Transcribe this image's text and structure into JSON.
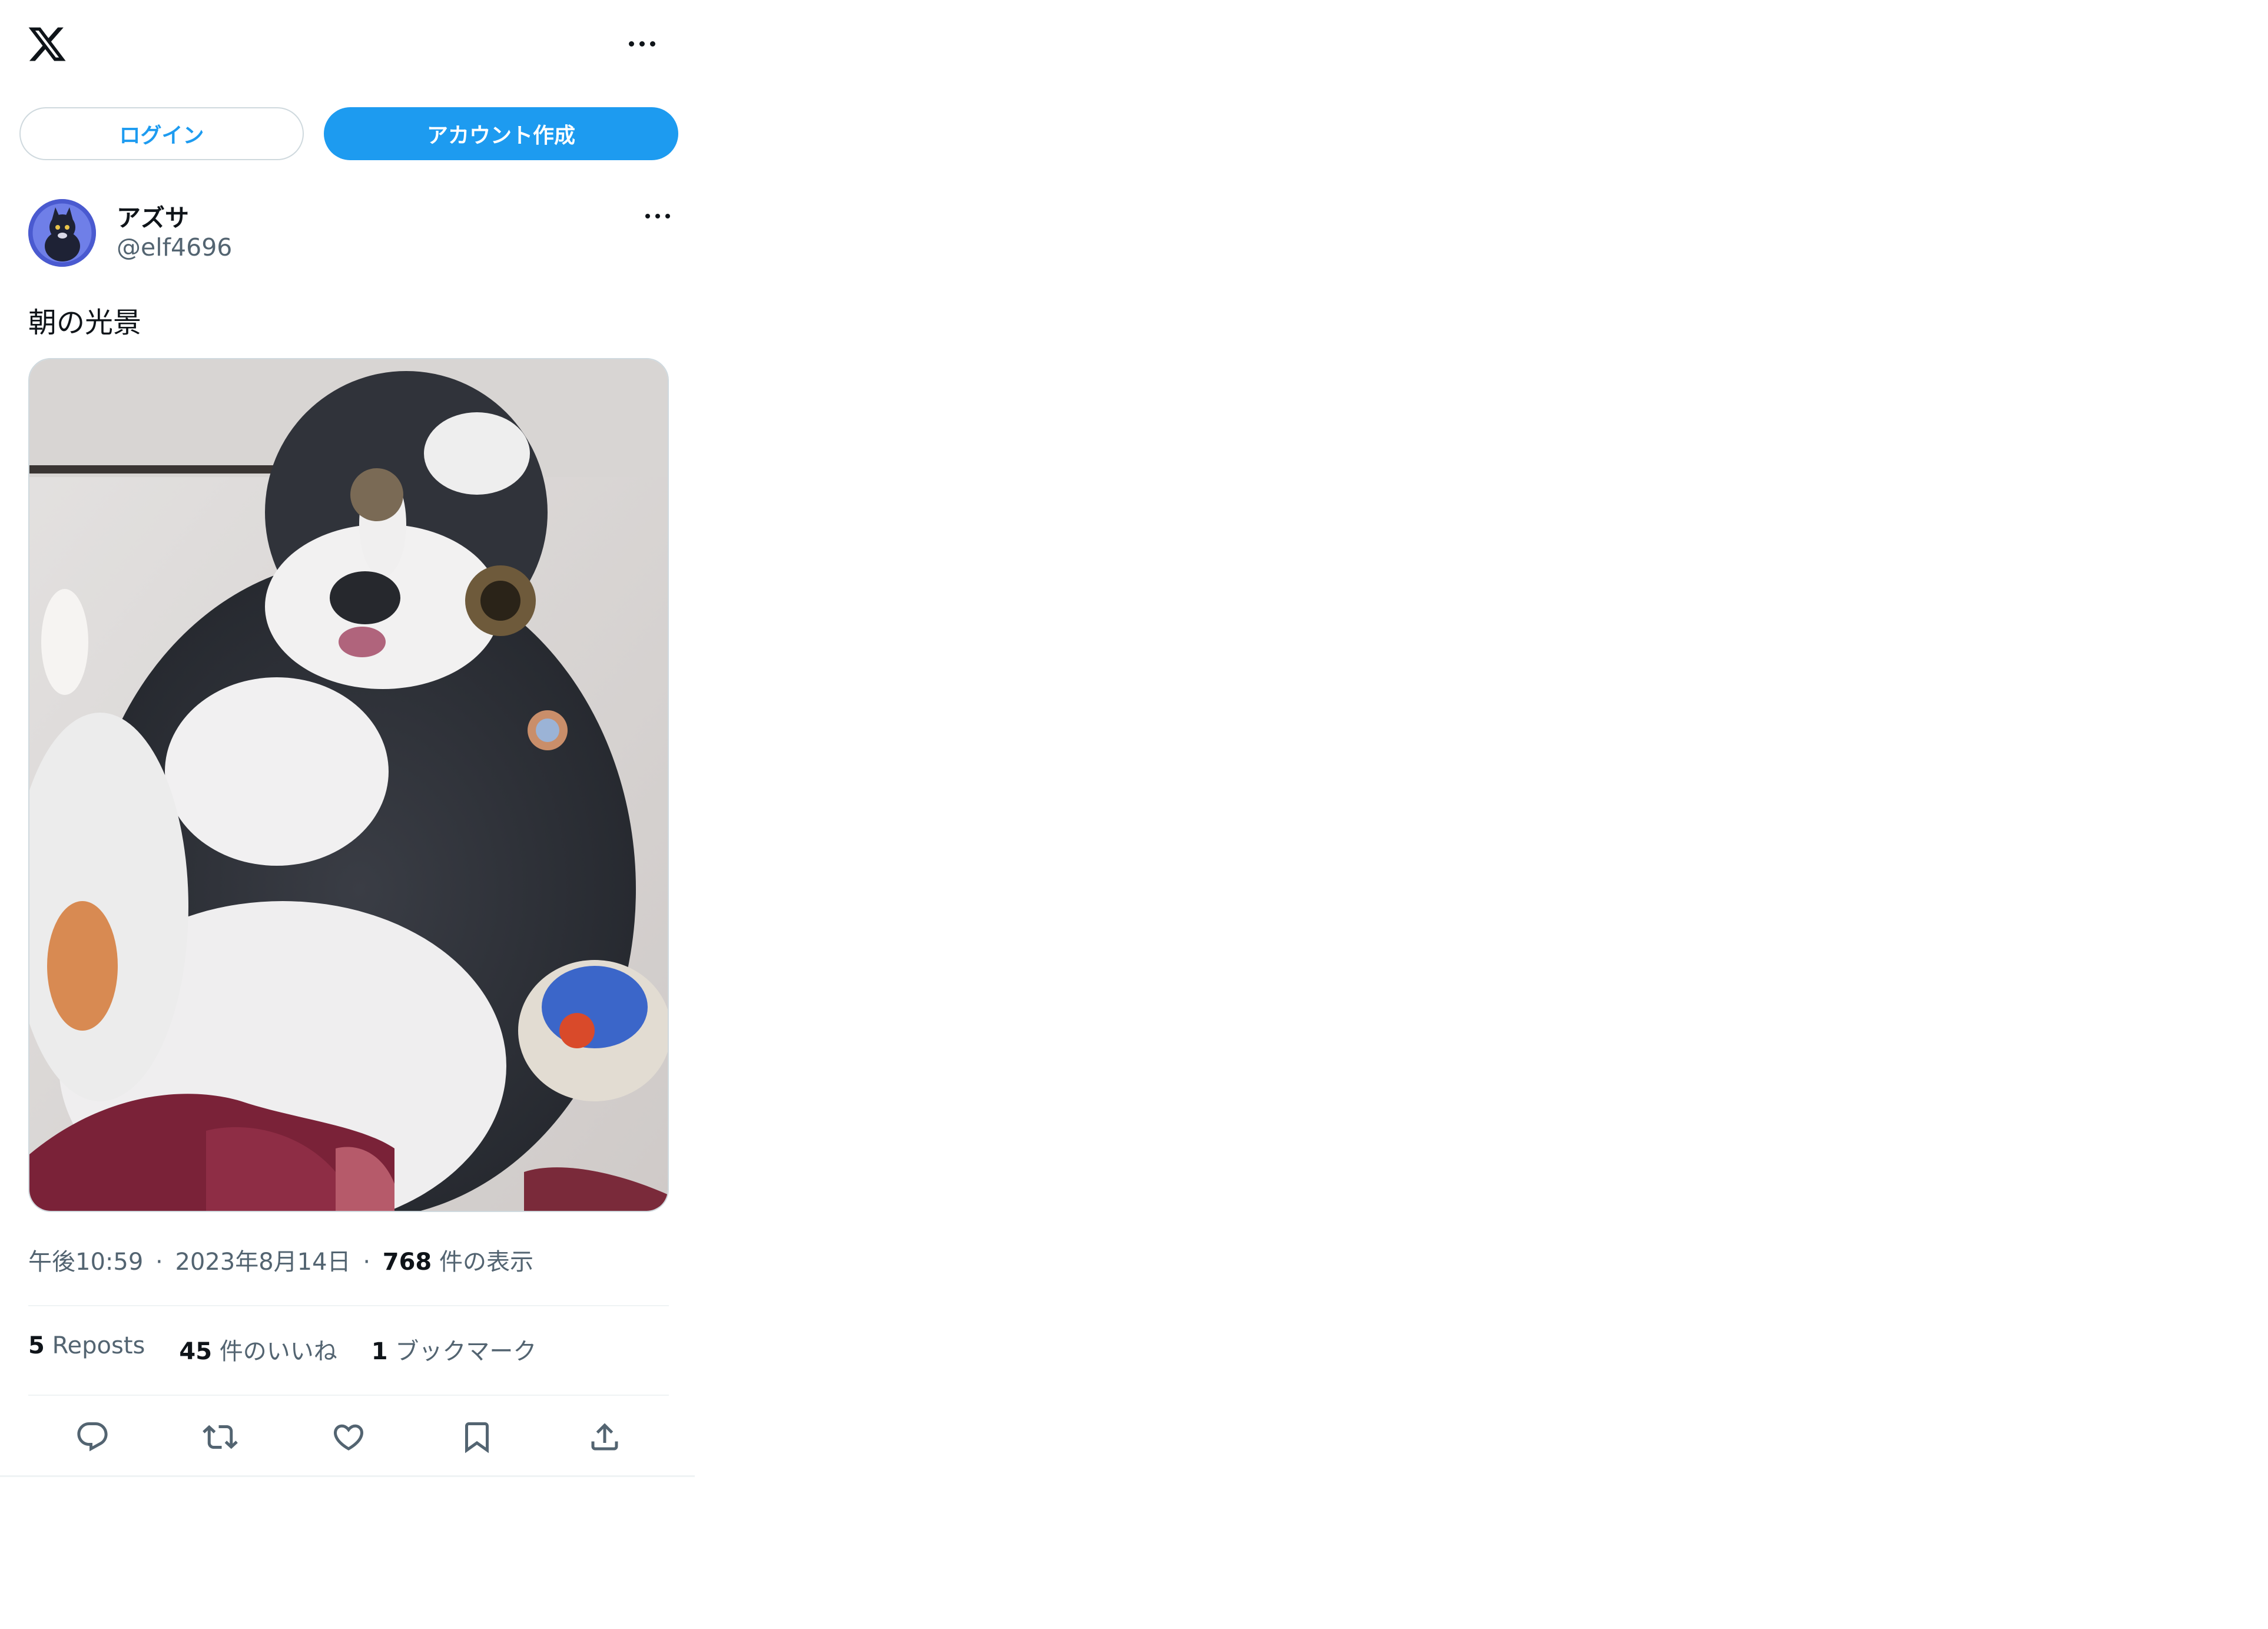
{
  "header": {
    "logo_icon": "x-logo-icon",
    "more_icon": "more-horizontal-icon"
  },
  "auth": {
    "login_label": "ログイン",
    "signup_label": "アカウント作成"
  },
  "tweet": {
    "author_name": "アズサ",
    "author_handle": "@elf4696",
    "text": "朝の光景",
    "time": "午後10:59",
    "date": "2023年8月14日",
    "views_count": "768",
    "views_label": "件の表示",
    "reposts_count": "5",
    "reposts_label": "Reposts",
    "likes_count": "45",
    "likes_label": "件のいいね",
    "bookmarks_count": "1",
    "bookmarks_label": "ブックマーク",
    "separator": "·"
  },
  "colors": {
    "accent": "#1d9bf0",
    "text": "#0f1419",
    "secondary": "#536471",
    "border": "#cfd9de"
  },
  "actions": [
    "reply-icon",
    "repost-icon",
    "like-icon",
    "bookmark-icon",
    "share-icon"
  ]
}
